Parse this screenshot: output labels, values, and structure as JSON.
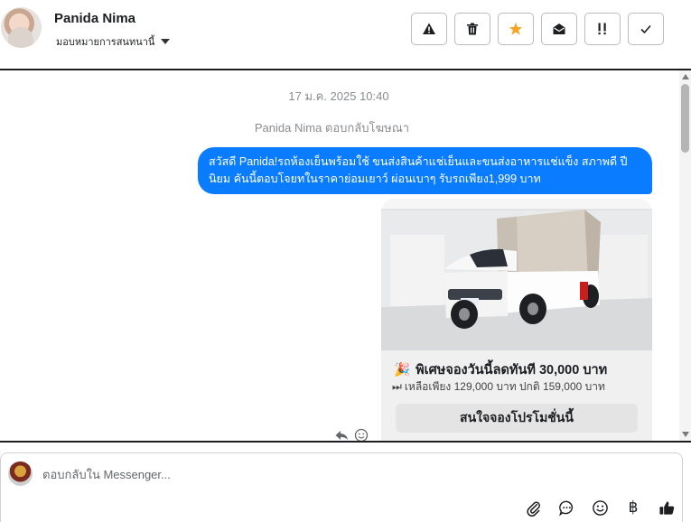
{
  "header": {
    "contact_name": "Panida Nima",
    "assign_label": "มอบหมายการสนทนานี้",
    "actions": [
      {
        "name": "report-spam-button",
        "icon": "warning-icon"
      },
      {
        "name": "delete-button",
        "icon": "trash-icon"
      },
      {
        "name": "star-button",
        "icon": "star-icon",
        "color": "#f5a623"
      },
      {
        "name": "mark-unread-button",
        "icon": "envelope-open-icon"
      },
      {
        "name": "follow-up-button",
        "icon": "exclamation-icon"
      },
      {
        "name": "mark-done-button",
        "icon": "check-icon"
      }
    ]
  },
  "conversation": {
    "date_stamp": "17 ม.ค. 2025 10:40",
    "reply_note": "Panida Nima ตอบกลับโฆษณา",
    "outgoing_message": "สวัสดี Panida!รถห้องเย็นพร้อมใช้ ขนส่งสินค้าแช่เย็นและขนส่งอาหารแช่แข็ง สภาพดี ปีนิยม คันนี้ตอบโจยทในราคาย่อมเยาว์ ผ่อนเบาๆ รับรถเพียง1,999 บาท",
    "bubble_color": "#0a7cff",
    "card": {
      "emoji": "🎉",
      "title": "พิเศษจองวันนี้ลดทันที 30,000 บาท",
      "sub_icon": "⏭",
      "subtitle": "เหลือเพียง 129,000 บาท ปกติ 159,000 บาท",
      "button_label": "สนใจจองโปรโมชั่นนี้"
    }
  },
  "composer": {
    "placeholder": "ตอบกลับใน Messenger...",
    "baht_symbol": "฿"
  }
}
